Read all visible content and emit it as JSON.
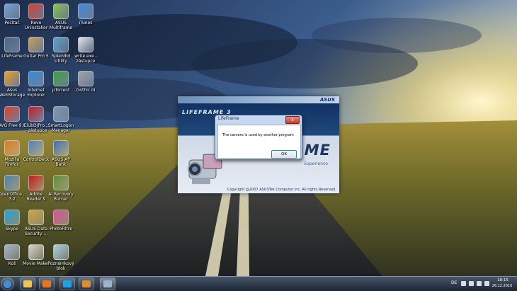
{
  "desktop": {
    "icons": [
      {
        "label": "Počítač",
        "icon": "computer-icon",
        "color": "#6fa3d8"
      },
      {
        "label": "Revo\nUninstaller",
        "icon": "revo-uninstaller-icon",
        "color": "#d94032"
      },
      {
        "label": "ASUS\nMultiframe",
        "icon": "asus-multiframe-icon",
        "color": "#8bc34a"
      },
      {
        "label": "iTunes",
        "icon": "itunes-icon",
        "color": "#3f8de0"
      },
      {
        "label": "LifeFrame",
        "icon": "lifeframe-icon",
        "color": "#4a6b8f"
      },
      {
        "label": "Guitar Pro 5",
        "icon": "guitar-pro-icon",
        "color": "#c9a055"
      },
      {
        "label": "Splendid\nUtility",
        "icon": "splendid-utility-icon",
        "color": "#5aa0c8"
      },
      {
        "label": "write.exe -\nzástupce",
        "icon": "write-icon",
        "color": "#dfe6ee"
      },
      {
        "label": "Asus\nWebStorage",
        "icon": "asus-webstorage-icon",
        "color": "#f0a020"
      },
      {
        "label": "Internet\nExplorer",
        "icon": "internet-explorer-icon",
        "color": "#2f8fe0"
      },
      {
        "label": "µTorrent",
        "icon": "utorrent-icon",
        "color": "#3aa13a"
      },
      {
        "label": "Gothic III",
        "icon": "gothic-icon",
        "color": "#9aa1a8"
      },
      {
        "label": "AVG Free 9.0",
        "icon": "avg-icon",
        "color": "#e0412a"
      },
      {
        "label": "ClubDJPro...\n- zástupce",
        "icon": "clubdj-icon",
        "color": "#c8202a"
      },
      {
        "label": "SmartLogon\nManager",
        "icon": "smartlogon-icon",
        "color": "#7f9bb5"
      },
      {
        "label": "Mozilla\nFirefox",
        "icon": "firefox-icon",
        "color": "#e5761d"
      },
      {
        "label": "ControlDeck",
        "icon": "controldeck-icon",
        "color": "#4d7fc4"
      },
      {
        "label": "ASUS AP\nBank",
        "icon": "asus-ap-bank-icon",
        "color": "#3a6fb6"
      },
      {
        "label": "OpenOffice...\n3.2",
        "icon": "openoffice-icon",
        "color": "#4f7fb9"
      },
      {
        "label": "Adobe\nReader 9",
        "icon": "adobe-reader-icon",
        "color": "#c8141a"
      },
      {
        "label": "AI Recovery\nBurner",
        "icon": "ai-recovery-icon",
        "color": "#5c8d3c"
      },
      {
        "label": "Skype",
        "icon": "skype-icon",
        "color": "#1da2e5"
      },
      {
        "label": "ASUS Data\nSecurity ...",
        "icon": "asus-data-security-icon",
        "color": "#cfa53a"
      },
      {
        "label": "PhotoFiltre",
        "icon": "photofiltre-icon",
        "color": "#e04c9a"
      },
      {
        "label": "Koš",
        "icon": "recycle-bin-icon",
        "color": "#9eb5cf"
      },
      {
        "label": "Movie Maker",
        "icon": "movie-maker-icon",
        "color": "#d7d3c6"
      },
      {
        "label": "Poznámkový\nblok",
        "icon": "notepad-icon",
        "color": "#a9cfe8"
      }
    ]
  },
  "splash": {
    "vendor": "ASUS",
    "logo": "LIFEFRAME 3",
    "product_word": "FRAME",
    "tagline": "Experience",
    "copyright": "Copyright @2007 ASUSTek Computer Inc. All rights Reserved."
  },
  "dialog": {
    "title": "LifeFrame",
    "close_label": "x",
    "message": "The camera is used by another program",
    "ok_label": "OK"
  },
  "taskbar": {
    "items": [
      {
        "icon": "windows-start-icon",
        "color": "#3d8fd6"
      },
      {
        "icon": "explorer-folder-icon",
        "color": "#f0c550"
      },
      {
        "icon": "firefox-icon",
        "color": "#e5761d"
      },
      {
        "icon": "skype-icon",
        "color": "#1da2e5"
      },
      {
        "icon": "media-player-icon",
        "color": "#e28b2a"
      },
      {
        "icon": "lifeframe-icon",
        "color": "#9eb3cc"
      }
    ],
    "language": "DE",
    "time": "18:15",
    "date": "26.12.2010"
  },
  "colors": {
    "taskbar_top": "#48566a",
    "taskbar_bottom": "#1c2433",
    "dialog_frame": "#c6d8ee",
    "close_red": "#c2402a"
  }
}
